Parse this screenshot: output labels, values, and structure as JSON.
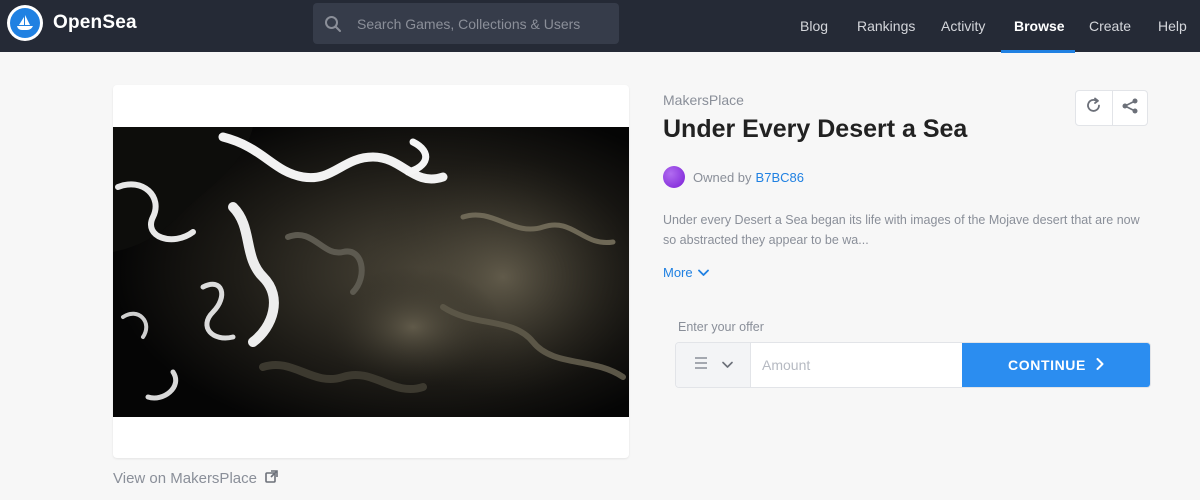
{
  "header": {
    "brand": "OpenSea",
    "search_placeholder": "Search Games, Collections & Users",
    "nav": [
      {
        "label": "Blog"
      },
      {
        "label": "Rankings"
      },
      {
        "label": "Activity"
      },
      {
        "label": "Browse",
        "active": true
      },
      {
        "label": "Create"
      },
      {
        "label": "Help"
      }
    ]
  },
  "asset": {
    "collection": "MakersPlace",
    "title": "Under Every Desert a Sea",
    "owned_by_label": "Owned by",
    "owner": "B7BC86",
    "description": "Under every Desert a Sea began its life with images of the Mojave desert that are now so abstracted they appear to be wa...",
    "more_label": "More",
    "view_link": "View on MakersPlace"
  },
  "offer": {
    "label": "Enter your offer",
    "amount_placeholder": "Amount",
    "currency_icon": "menu-icon",
    "continue_label": "CONTINUE"
  },
  "colors": {
    "nav_bg": "#252a36",
    "accent": "#2081e2",
    "continue_bg": "#2b8df0",
    "page_bg": "#f7f7f7"
  },
  "icons": [
    "search-icon",
    "refresh-icon",
    "share-icon",
    "chevron-down-icon",
    "external-link-icon",
    "chevron-right-icon"
  ]
}
